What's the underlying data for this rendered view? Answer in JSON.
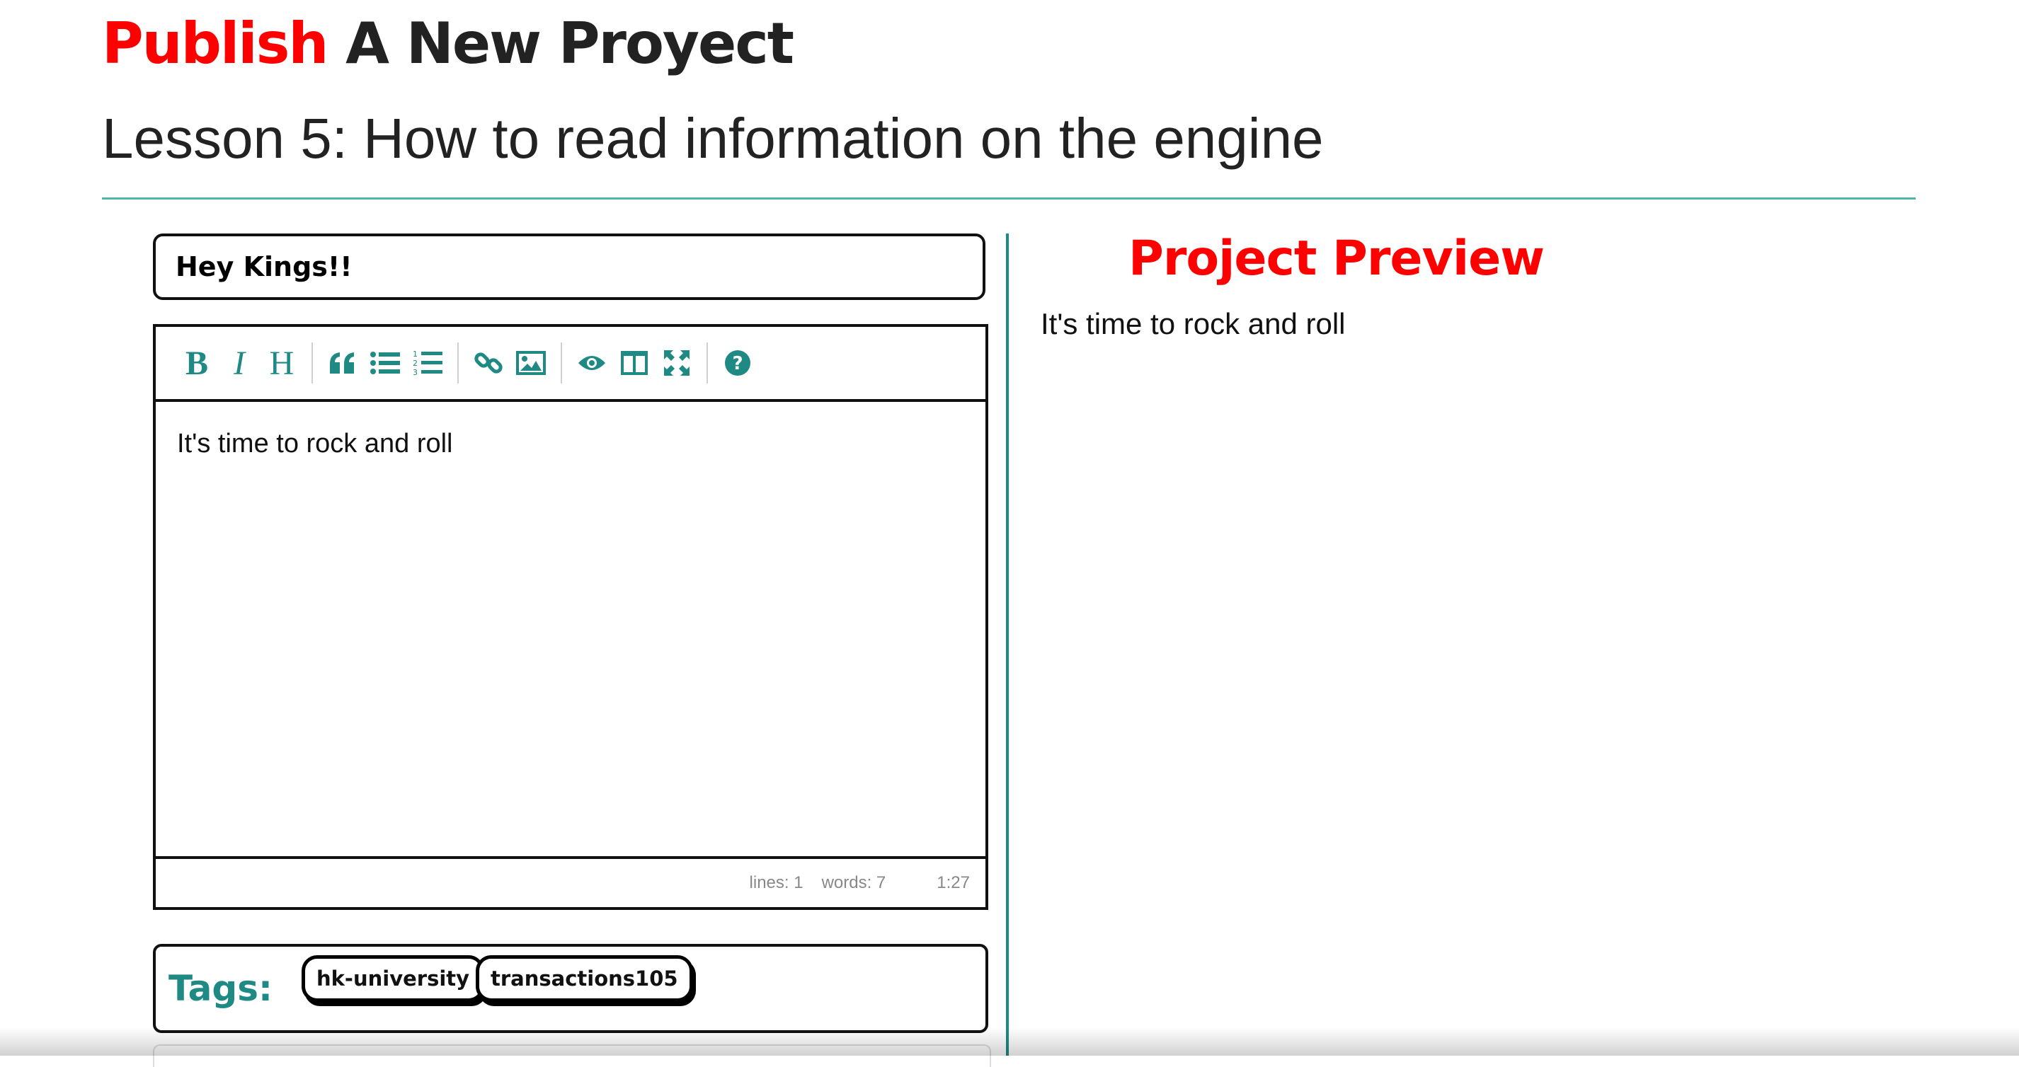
{
  "header": {
    "title_accent": "Publish",
    "title_rest": "A New Proyect",
    "lesson_title": "Lesson 5: How to read information on the engine"
  },
  "form": {
    "title_value": "Hey Kings!!"
  },
  "editor": {
    "toolbar": {
      "bold_label": "B",
      "italic_label": "I",
      "heading_label": "H",
      "buttons": [
        "bold-icon",
        "italic-icon",
        "heading-icon",
        "quote-icon",
        "unordered-list-icon",
        "ordered-list-icon",
        "link-icon",
        "image-icon",
        "preview-icon",
        "side-by-side-icon",
        "fullscreen-icon",
        "help-icon"
      ]
    },
    "content": "It's time to rock and roll",
    "status": {
      "lines": "lines: 1",
      "words": "words: 7",
      "cursor": "1:27"
    }
  },
  "tags": {
    "label": "Tags:",
    "items": [
      "hk-university",
      "transactions105"
    ]
  },
  "preview": {
    "title": "Project Preview",
    "content": "It's time to rock and roll"
  },
  "colors": {
    "accent_red": "#ff0000",
    "teal": "#1f8a84",
    "divider_teal": "#4fb3ad",
    "text_dark": "#222222"
  }
}
